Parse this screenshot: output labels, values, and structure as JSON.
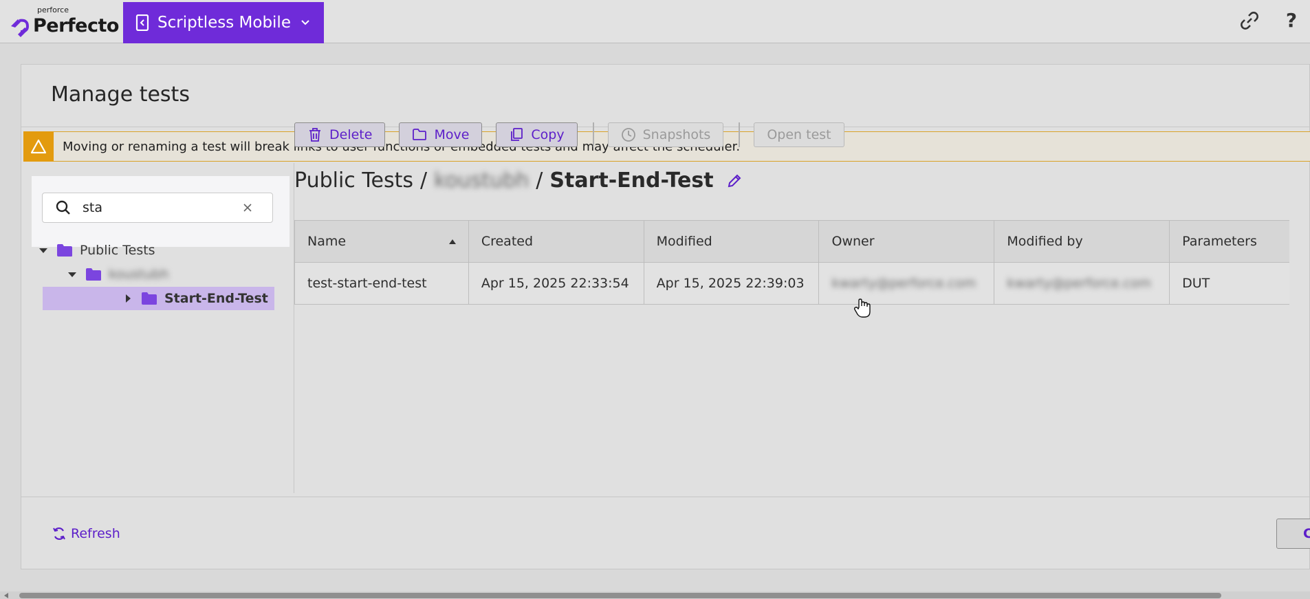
{
  "topbar": {
    "brand_small": "perforce",
    "brand_name": "Perfecto",
    "app_switcher_label": "Scriptless Mobile",
    "help_label": "?"
  },
  "page": {
    "title": "Manage tests",
    "warning": "Moving or renaming a test will break links to user functions or embedded tests and may affect the scheduler."
  },
  "tree": {
    "search_value": "sta",
    "items": [
      {
        "label": "Public Tests",
        "expanded": true
      },
      {
        "label": "koustubh",
        "expanded": true,
        "blurred": true
      },
      {
        "label": "Start-End-Test",
        "expanded": false,
        "selected": true
      }
    ]
  },
  "toolbar": {
    "delete_label": "Delete",
    "move_label": "Move",
    "copy_label": "Copy",
    "snapshots_label": "Snapshots",
    "open_label": "Open test"
  },
  "breadcrumb": {
    "root": "Public Tests",
    "folder": "koustubh",
    "current": "Start-End-Test",
    "separator": "/"
  },
  "table": {
    "columns": [
      "Name",
      "Created",
      "Modified",
      "Owner",
      "Modified by",
      "Parameters"
    ],
    "sorted_column": "Name",
    "sort_direction": "ascending",
    "rows": [
      [
        "test-start-end-test",
        "Apr 15, 2025 22:33:54",
        "Apr 15, 2025 22:39:03",
        "kwarty@perforce.com",
        "kwarty@perforce.com",
        "DUT"
      ]
    ]
  },
  "footer": {
    "refresh_label": "Refresh",
    "close_label": "C"
  },
  "colors": {
    "accent": "#6f2bd9",
    "link": "#5c1ec9",
    "warning": "#e39b0f",
    "selected_row": "#c9b6ea"
  }
}
